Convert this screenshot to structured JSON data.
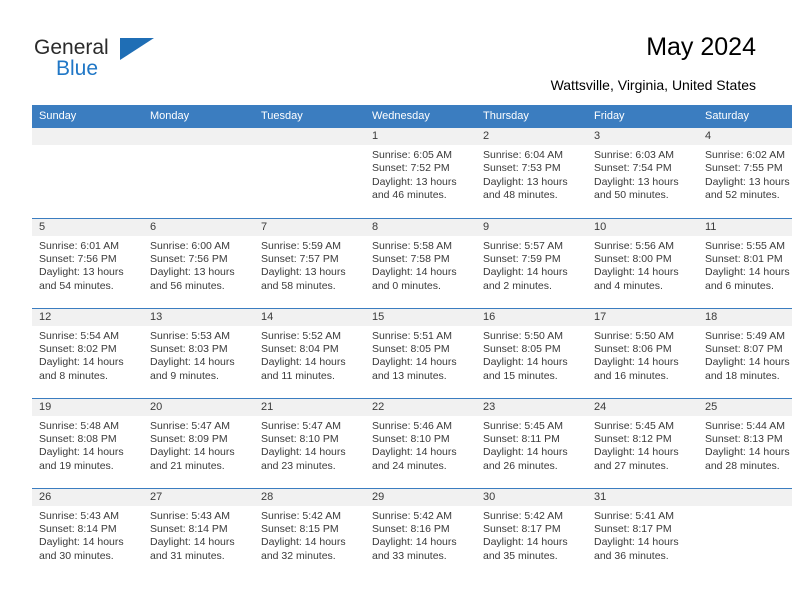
{
  "brand": {
    "name_top": "General",
    "name_bottom": "Blue",
    "triangle_color": "#1f6eb5",
    "blue_text_color": "#2077c6"
  },
  "header": {
    "title": "May 2024",
    "subtitle": "Wattsville, Virginia, United States"
  },
  "theme": {
    "header_row_bg": "#3b7dc0",
    "header_row_text": "#ffffff",
    "daynum_band_bg": "#f1f1f1",
    "row_divider": "#3b7dc0",
    "body_text": "#3a3a3a"
  },
  "calendar": {
    "weekday_headers": [
      "Sunday",
      "Monday",
      "Tuesday",
      "Wednesday",
      "Thursday",
      "Friday",
      "Saturday"
    ],
    "weeks": [
      [
        {
          "day": "",
          "empty": true
        },
        {
          "day": "",
          "empty": true
        },
        {
          "day": "",
          "empty": true
        },
        {
          "day": "1",
          "sunrise": "Sunrise: 6:05 AM",
          "sunset": "Sunset: 7:52 PM",
          "daylight1": "Daylight: 13 hours",
          "daylight2": "and 46 minutes."
        },
        {
          "day": "2",
          "sunrise": "Sunrise: 6:04 AM",
          "sunset": "Sunset: 7:53 PM",
          "daylight1": "Daylight: 13 hours",
          "daylight2": "and 48 minutes."
        },
        {
          "day": "3",
          "sunrise": "Sunrise: 6:03 AM",
          "sunset": "Sunset: 7:54 PM",
          "daylight1": "Daylight: 13 hours",
          "daylight2": "and 50 minutes."
        },
        {
          "day": "4",
          "sunrise": "Sunrise: 6:02 AM",
          "sunset": "Sunset: 7:55 PM",
          "daylight1": "Daylight: 13 hours",
          "daylight2": "and 52 minutes."
        }
      ],
      [
        {
          "day": "5",
          "sunrise": "Sunrise: 6:01 AM",
          "sunset": "Sunset: 7:56 PM",
          "daylight1": "Daylight: 13 hours",
          "daylight2": "and 54 minutes."
        },
        {
          "day": "6",
          "sunrise": "Sunrise: 6:00 AM",
          "sunset": "Sunset: 7:56 PM",
          "daylight1": "Daylight: 13 hours",
          "daylight2": "and 56 minutes."
        },
        {
          "day": "7",
          "sunrise": "Sunrise: 5:59 AM",
          "sunset": "Sunset: 7:57 PM",
          "daylight1": "Daylight: 13 hours",
          "daylight2": "and 58 minutes."
        },
        {
          "day": "8",
          "sunrise": "Sunrise: 5:58 AM",
          "sunset": "Sunset: 7:58 PM",
          "daylight1": "Daylight: 14 hours",
          "daylight2": "and 0 minutes."
        },
        {
          "day": "9",
          "sunrise": "Sunrise: 5:57 AM",
          "sunset": "Sunset: 7:59 PM",
          "daylight1": "Daylight: 14 hours",
          "daylight2": "and 2 minutes."
        },
        {
          "day": "10",
          "sunrise": "Sunrise: 5:56 AM",
          "sunset": "Sunset: 8:00 PM",
          "daylight1": "Daylight: 14 hours",
          "daylight2": "and 4 minutes."
        },
        {
          "day": "11",
          "sunrise": "Sunrise: 5:55 AM",
          "sunset": "Sunset: 8:01 PM",
          "daylight1": "Daylight: 14 hours",
          "daylight2": "and 6 minutes."
        }
      ],
      [
        {
          "day": "12",
          "sunrise": "Sunrise: 5:54 AM",
          "sunset": "Sunset: 8:02 PM",
          "daylight1": "Daylight: 14 hours",
          "daylight2": "and 8 minutes."
        },
        {
          "day": "13",
          "sunrise": "Sunrise: 5:53 AM",
          "sunset": "Sunset: 8:03 PM",
          "daylight1": "Daylight: 14 hours",
          "daylight2": "and 9 minutes."
        },
        {
          "day": "14",
          "sunrise": "Sunrise: 5:52 AM",
          "sunset": "Sunset: 8:04 PM",
          "daylight1": "Daylight: 14 hours",
          "daylight2": "and 11 minutes."
        },
        {
          "day": "15",
          "sunrise": "Sunrise: 5:51 AM",
          "sunset": "Sunset: 8:05 PM",
          "daylight1": "Daylight: 14 hours",
          "daylight2": "and 13 minutes."
        },
        {
          "day": "16",
          "sunrise": "Sunrise: 5:50 AM",
          "sunset": "Sunset: 8:05 PM",
          "daylight1": "Daylight: 14 hours",
          "daylight2": "and 15 minutes."
        },
        {
          "day": "17",
          "sunrise": "Sunrise: 5:50 AM",
          "sunset": "Sunset: 8:06 PM",
          "daylight1": "Daylight: 14 hours",
          "daylight2": "and 16 minutes."
        },
        {
          "day": "18",
          "sunrise": "Sunrise: 5:49 AM",
          "sunset": "Sunset: 8:07 PM",
          "daylight1": "Daylight: 14 hours",
          "daylight2": "and 18 minutes."
        }
      ],
      [
        {
          "day": "19",
          "sunrise": "Sunrise: 5:48 AM",
          "sunset": "Sunset: 8:08 PM",
          "daylight1": "Daylight: 14 hours",
          "daylight2": "and 19 minutes."
        },
        {
          "day": "20",
          "sunrise": "Sunrise: 5:47 AM",
          "sunset": "Sunset: 8:09 PM",
          "daylight1": "Daylight: 14 hours",
          "daylight2": "and 21 minutes."
        },
        {
          "day": "21",
          "sunrise": "Sunrise: 5:47 AM",
          "sunset": "Sunset: 8:10 PM",
          "daylight1": "Daylight: 14 hours",
          "daylight2": "and 23 minutes."
        },
        {
          "day": "22",
          "sunrise": "Sunrise: 5:46 AM",
          "sunset": "Sunset: 8:10 PM",
          "daylight1": "Daylight: 14 hours",
          "daylight2": "and 24 minutes."
        },
        {
          "day": "23",
          "sunrise": "Sunrise: 5:45 AM",
          "sunset": "Sunset: 8:11 PM",
          "daylight1": "Daylight: 14 hours",
          "daylight2": "and 26 minutes."
        },
        {
          "day": "24",
          "sunrise": "Sunrise: 5:45 AM",
          "sunset": "Sunset: 8:12 PM",
          "daylight1": "Daylight: 14 hours",
          "daylight2": "and 27 minutes."
        },
        {
          "day": "25",
          "sunrise": "Sunrise: 5:44 AM",
          "sunset": "Sunset: 8:13 PM",
          "daylight1": "Daylight: 14 hours",
          "daylight2": "and 28 minutes."
        }
      ],
      [
        {
          "day": "26",
          "sunrise": "Sunrise: 5:43 AM",
          "sunset": "Sunset: 8:14 PM",
          "daylight1": "Daylight: 14 hours",
          "daylight2": "and 30 minutes."
        },
        {
          "day": "27",
          "sunrise": "Sunrise: 5:43 AM",
          "sunset": "Sunset: 8:14 PM",
          "daylight1": "Daylight: 14 hours",
          "daylight2": "and 31 minutes."
        },
        {
          "day": "28",
          "sunrise": "Sunrise: 5:42 AM",
          "sunset": "Sunset: 8:15 PM",
          "daylight1": "Daylight: 14 hours",
          "daylight2": "and 32 minutes."
        },
        {
          "day": "29",
          "sunrise": "Sunrise: 5:42 AM",
          "sunset": "Sunset: 8:16 PM",
          "daylight1": "Daylight: 14 hours",
          "daylight2": "and 33 minutes."
        },
        {
          "day": "30",
          "sunrise": "Sunrise: 5:42 AM",
          "sunset": "Sunset: 8:17 PM",
          "daylight1": "Daylight: 14 hours",
          "daylight2": "and 35 minutes."
        },
        {
          "day": "31",
          "sunrise": "Sunrise: 5:41 AM",
          "sunset": "Sunset: 8:17 PM",
          "daylight1": "Daylight: 14 hours",
          "daylight2": "and 36 minutes."
        },
        {
          "day": "",
          "empty": true
        }
      ]
    ]
  }
}
